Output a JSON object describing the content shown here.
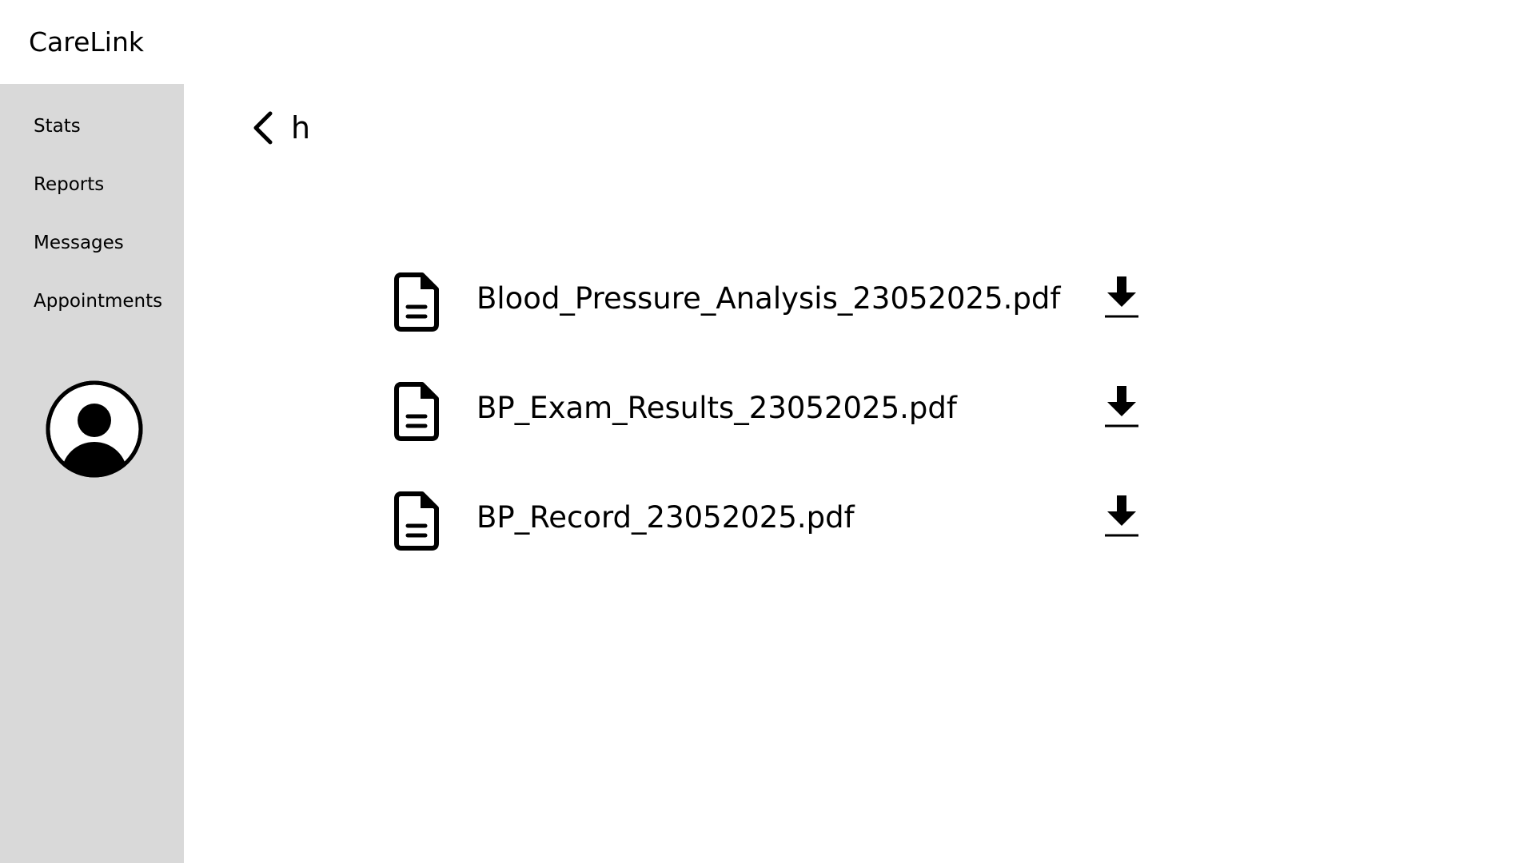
{
  "app": {
    "brand": "CareLink"
  },
  "sidebar": {
    "items": [
      {
        "label": "Stats"
      },
      {
        "label": "Reports"
      },
      {
        "label": "Messages"
      },
      {
        "label": "Appointments"
      }
    ],
    "avatar_icon": "user-circle-icon"
  },
  "header": {
    "back_icon": "chevron-left-icon",
    "title": "h"
  },
  "files": [
    {
      "name": "Blood_Pressure_Analysis_23052025.pdf",
      "icon": "file-icon",
      "action_icon": "download-icon"
    },
    {
      "name": "BP_Exam_Results_23052025.pdf",
      "icon": "file-icon",
      "action_icon": "download-icon"
    },
    {
      "name": "BP_Record_23052025.pdf",
      "icon": "file-icon",
      "action_icon": "download-icon"
    }
  ],
  "colors": {
    "sidebar_bg": "#d9d9d9",
    "page_bg": "#ffffff",
    "text": "#000000"
  }
}
